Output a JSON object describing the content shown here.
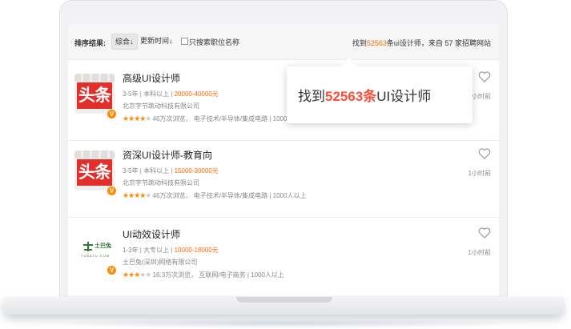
{
  "sortbar": {
    "label": "排序结果:",
    "option_composite": "综合↓",
    "option_updated": "更新时间↓",
    "checkbox_label": "只搜索职位名称",
    "summary_prefix": "找到",
    "summary_count": "52563",
    "summary_mid": "条ui设计师，来自",
    "summary_sites": "57",
    "summary_suffix": "家招聘网站"
  },
  "tooltip": {
    "prefix": "找到",
    "count": "52563条",
    "suffix": "UI设计师"
  },
  "jobs": [
    {
      "title": "高级UI设计师",
      "meta_prefix": "3-5年 | 本科以上 | ",
      "salary": "20000-40000元",
      "company": "北京字节跳动科技有限公司",
      "stars": 4,
      "rating_text": "46万次浏览，  电子技术/半导体/集成电路 | 1000人以上",
      "time": "1小时前",
      "logo_text": "头条",
      "verified": "V"
    },
    {
      "title": "资深UI设计师-教育向",
      "meta_prefix": "3-5年 | 本科以上 | ",
      "salary": "15000-30000元",
      "company": "北京字节跳动科技有限公司",
      "stars": 4,
      "rating_text": "46万次浏览，  电子技术/半导体/集成电路 | 1000人以上",
      "time": "1小时前",
      "logo_text": "头条",
      "verified": "V"
    },
    {
      "title": "UI动效设计师",
      "meta_prefix": "1-3年 | 大专以上 | ",
      "salary": "10000-18000元",
      "company": "土巴兔(深圳)网络有限公司",
      "stars": 3,
      "rating_text": "16.3万次浏览，  互联网/电子商务 | 1000人以上",
      "time": "1小时前",
      "logo_text": "土巴兔",
      "logo_sub": "TUBATU.COM",
      "verified": "V"
    }
  ],
  "colors": {
    "accent": "#ff6a00",
    "star": "#ff8a00",
    "tooltip_number": "#ff4e37",
    "logo_red": "#e32f2c",
    "logo_green": "#2b7a3b"
  },
  "icons": {
    "favorite": "heart-outline-icon",
    "verified": "verified-badge-icon"
  }
}
